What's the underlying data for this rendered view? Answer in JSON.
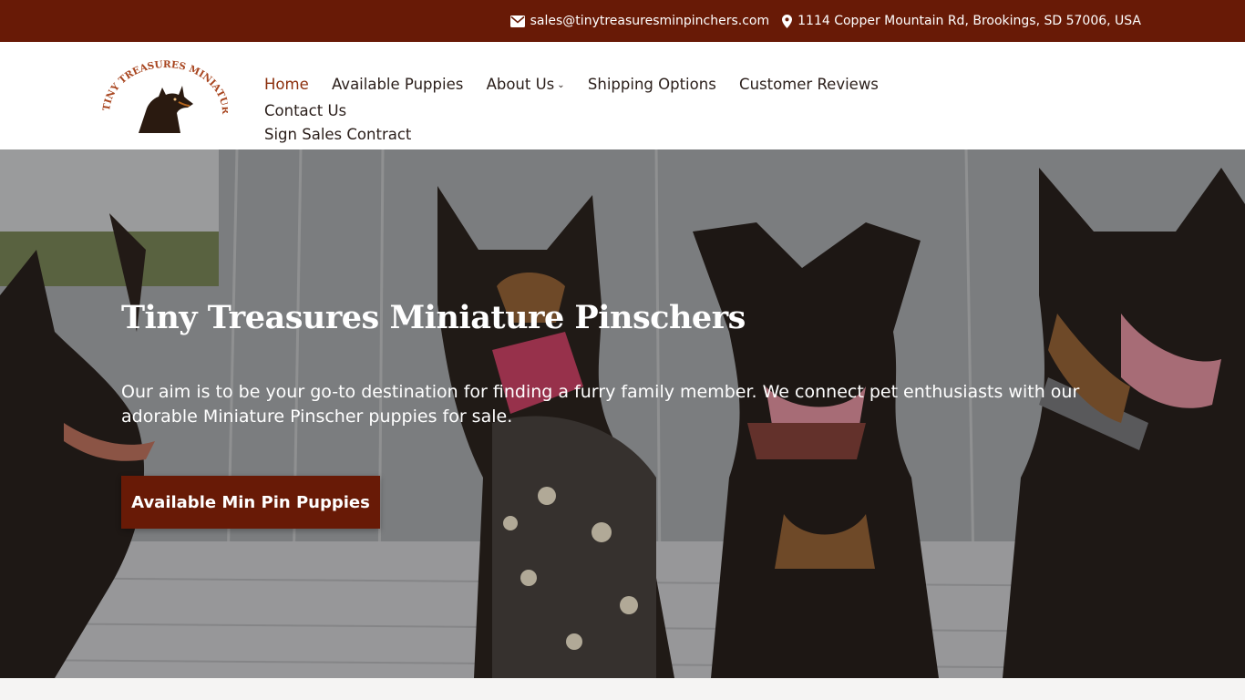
{
  "topbar": {
    "email": "sales@tinytreasuresminpinchers.com",
    "email_icon": "envelope-icon",
    "address": "1114 Copper Mountain Rd, Brookings, SD 57006, USA",
    "address_icon": "map-pin-icon"
  },
  "logo": {
    "text": "TINY TREASURES MINIATURE PINSCHERS"
  },
  "nav": {
    "items": [
      {
        "label": "Home",
        "active": true
      },
      {
        "label": "Available Puppies"
      },
      {
        "label": "About Us",
        "has_dropdown": true
      },
      {
        "label": "Shipping Options"
      },
      {
        "label": "Customer Reviews"
      },
      {
        "label": "Contact Us"
      },
      {
        "label": "Sign Sales Contract"
      }
    ]
  },
  "hero": {
    "title": "Tiny Treasures Miniature Pinschers",
    "text": "Our aim is to be your go-to destination for finding a furry family member. We connect pet enthusiasts with our adorable Miniature Pinscher puppies for sale.",
    "button_label": "Available Min Pin Puppies"
  },
  "colors": {
    "brand": "#681a06",
    "nav_active": "#8b2e0b"
  }
}
